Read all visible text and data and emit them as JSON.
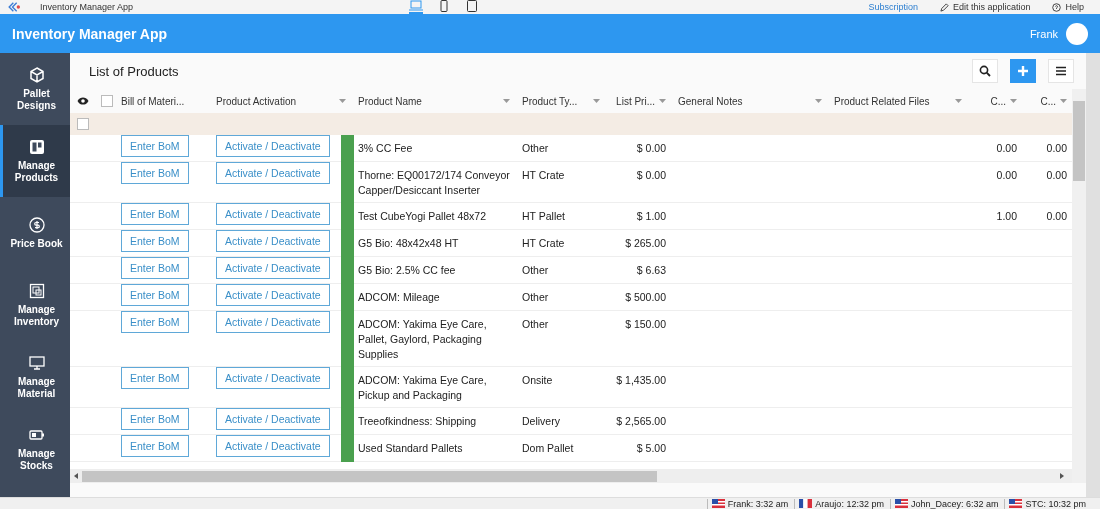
{
  "top_bar": {
    "app_name": "Inventory Manager App",
    "devices": [
      {
        "selected": true
      },
      {
        "selected": false
      },
      {
        "selected": false
      }
    ],
    "links": [
      "Subscription",
      "Edit this application",
      "Help"
    ]
  },
  "header": {
    "title": "Inventory Manager App",
    "user": "Frank"
  },
  "sidebar": {
    "items": [
      {
        "label": "Pallet Designs",
        "selected": false
      },
      {
        "label": "Manage Products",
        "selected": true
      },
      {
        "label": "Price Book",
        "selected": false
      },
      {
        "label": "Manage Inventory",
        "selected": false
      },
      {
        "label": "Manage Material",
        "selected": false
      },
      {
        "label": "Manage Stocks",
        "selected": false
      }
    ]
  },
  "page": {
    "title": "List of Products"
  },
  "table": {
    "select_all": {
      "checked": false
    },
    "filter_checkbox": {
      "checked": false
    },
    "columns": [
      {
        "label": "Bill of Materi...",
        "sortable": false
      },
      {
        "label": "Product Activation",
        "sortable": true
      },
      {
        "label": "Product Name",
        "sortable": true
      },
      {
        "label": "Product Ty...",
        "sortable": true
      },
      {
        "label": "List Pri...",
        "sortable": true
      },
      {
        "label": "General Notes",
        "sortable": true
      },
      {
        "label": "Product Related Files",
        "sortable": true
      },
      {
        "label": "C...",
        "sortable": true
      },
      {
        "label": "C...",
        "sortable": true
      }
    ],
    "rows": [
      {
        "bom": "Enter BoM",
        "activation": "Activate / Deactivate",
        "active": true,
        "name": "3% CC Fee",
        "type": "Other",
        "price": "$ 0.00",
        "c1": "0.00",
        "c2": "0.00"
      },
      {
        "bom": "Enter BoM",
        "activation": "Activate / Deactivate",
        "active": true,
        "name": "Thorne: EQ00172/174 Conveyor Capper/Desiccant Inserter",
        "type": "HT Crate",
        "price": "$ 0.00",
        "c1": "0.00",
        "c2": "0.00"
      },
      {
        "bom": "Enter BoM",
        "activation": "Activate / Deactivate",
        "active": true,
        "name": "Test CubeYogi Pallet 48x72",
        "type": "HT Pallet",
        "price": "$ 1.00",
        "c1": "1.00",
        "c2": "0.00"
      },
      {
        "bom": "Enter BoM",
        "activation": "Activate / Deactivate",
        "active": true,
        "name": "G5 Bio: 48x42x48 HT",
        "type": "HT Crate",
        "price": "$ 265.00"
      },
      {
        "bom": "Enter BoM",
        "activation": "Activate / Deactivate",
        "active": true,
        "name": "G5 Bio: 2.5% CC fee",
        "type": "Other",
        "price": "$ 6.63"
      },
      {
        "bom": "Enter BoM",
        "activation": "Activate / Deactivate",
        "active": true,
        "name": "ADCOM: Mileage",
        "type": "Other",
        "price": "$ 500.00"
      },
      {
        "bom": "Enter BoM",
        "activation": "Activate / Deactivate",
        "active": true,
        "name": "ADCOM: Yakima Eye Care, Pallet, Gaylord, Packaging Supplies",
        "type": "Other",
        "price": "$ 150.00"
      },
      {
        "bom": "Enter BoM",
        "activation": "Activate / Deactivate",
        "active": true,
        "name": "ADCOM: Yakima Eye Care, Pickup and Packaging",
        "type": "Onsite",
        "price": "$ 1,435.00"
      },
      {
        "bom": "Enter BoM",
        "activation": "Activate / Deactivate",
        "active": true,
        "name": "Treeofkindness: Shipping",
        "type": "Delivery",
        "price": "$ 2,565.00"
      },
      {
        "bom": "Enter BoM",
        "activation": "Activate / Deactivate",
        "active": true,
        "name": "Used Standard Pallets",
        "type": "Dom Pallet",
        "price": "$ 5.00"
      }
    ]
  },
  "status_bar": {
    "clocks": [
      "Frank: 3:32 am",
      "Araujo: 12:32 pm",
      "John_Dacey: 6:32 am",
      "STC: 10:32 pm"
    ]
  }
}
